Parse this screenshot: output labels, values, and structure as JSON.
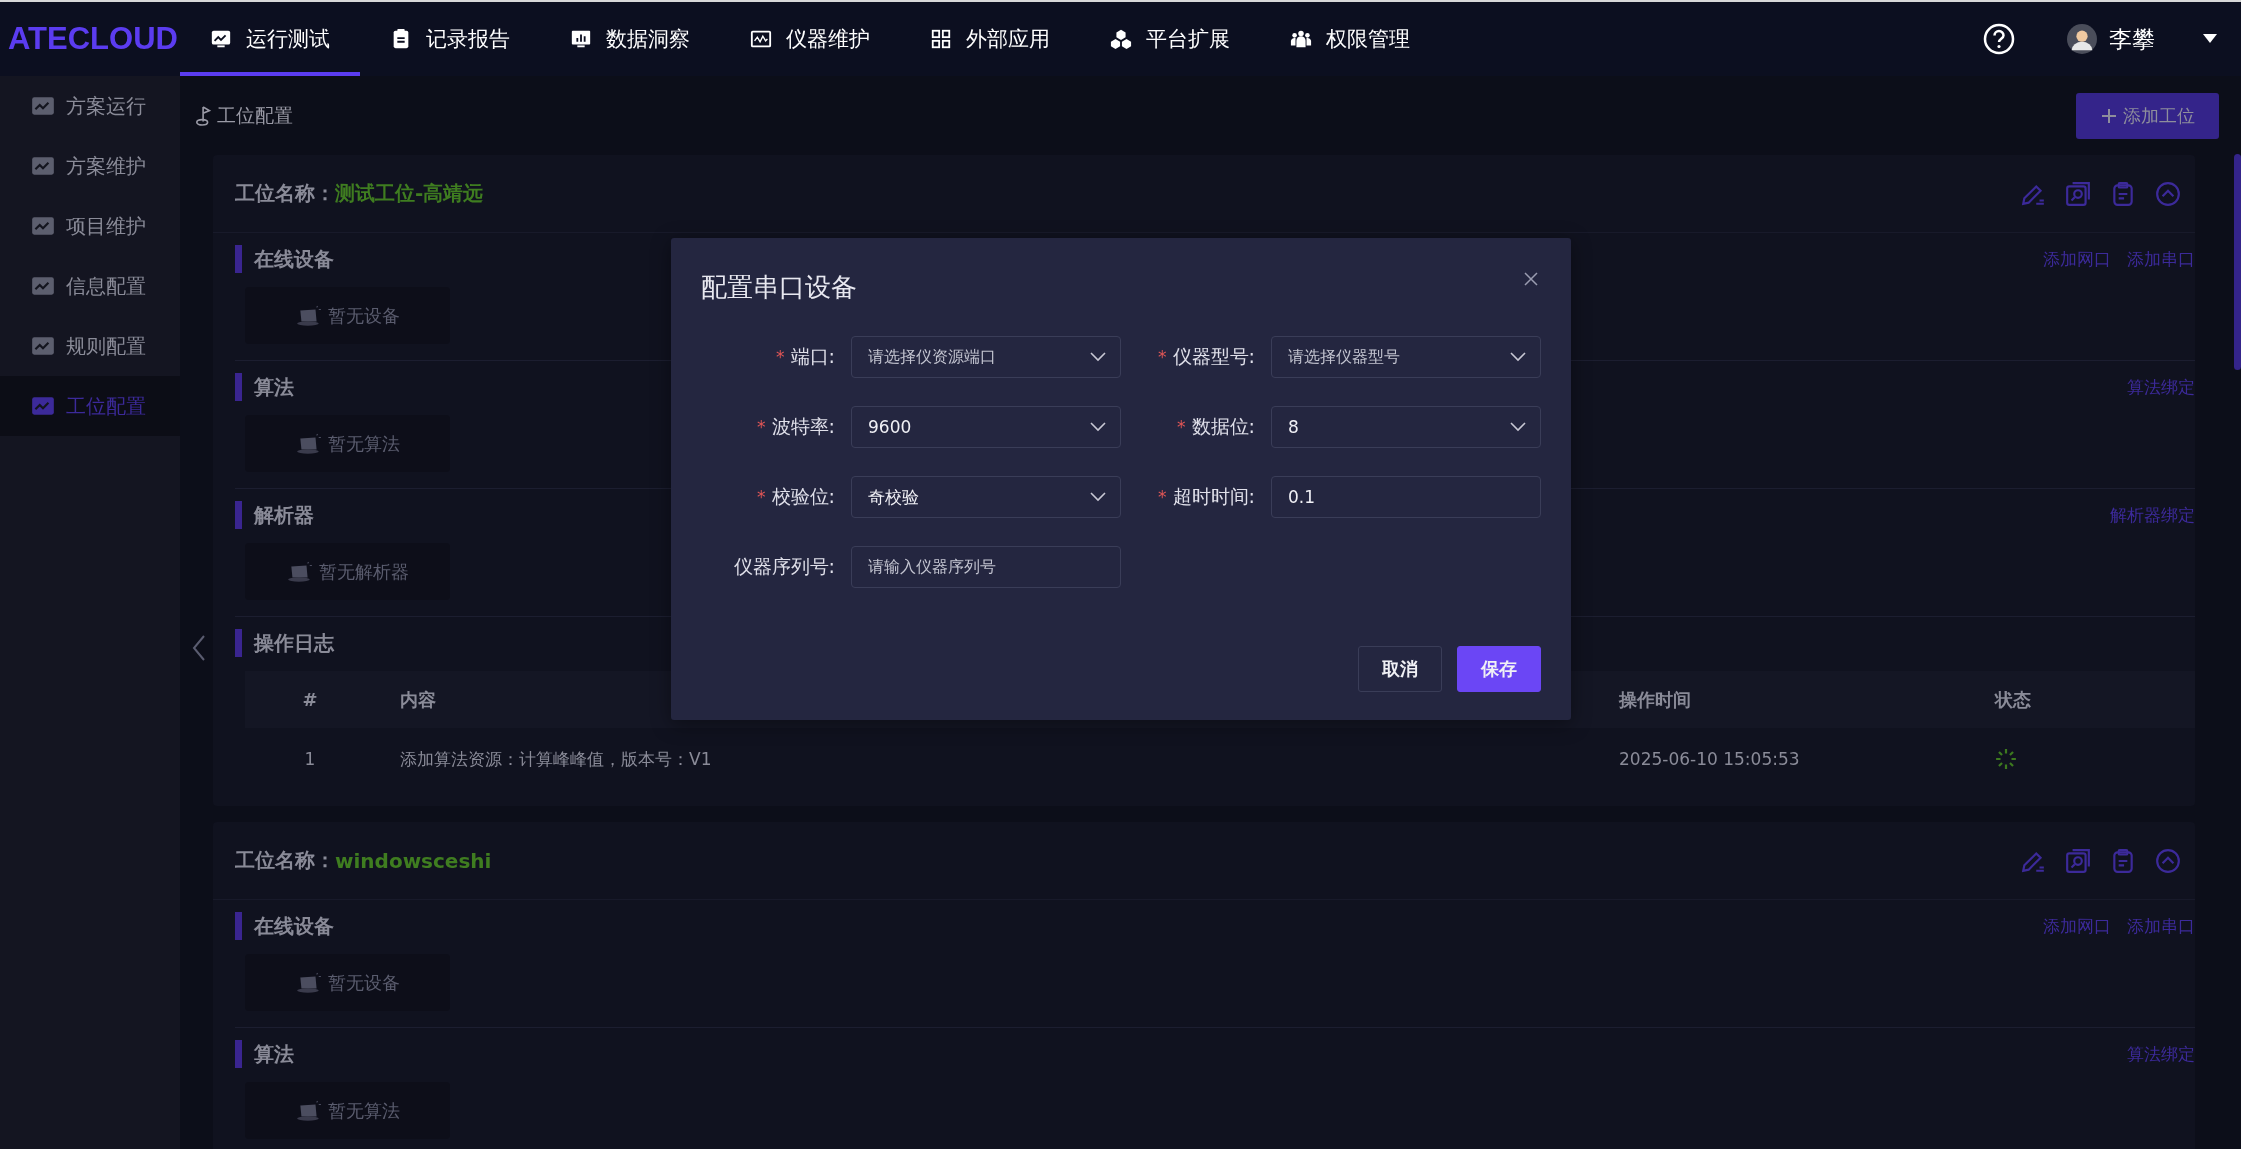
{
  "header": {
    "logo": "ATECLOUD",
    "nav": [
      {
        "label": "运行测试",
        "selected": true
      },
      {
        "label": "记录报告",
        "selected": false
      },
      {
        "label": "数据洞察",
        "selected": false
      },
      {
        "label": "仪器维护",
        "selected": false
      },
      {
        "label": "外部应用",
        "selected": false
      },
      {
        "label": "平台扩展",
        "selected": false
      },
      {
        "label": "权限管理",
        "selected": false
      }
    ],
    "user": "李攀"
  },
  "sidebar": {
    "items": [
      {
        "label": "方案运行",
        "selected": false
      },
      {
        "label": "方案维护",
        "selected": false
      },
      {
        "label": "项目维护",
        "selected": false
      },
      {
        "label": "信息配置",
        "selected": false
      },
      {
        "label": "规则配置",
        "selected": false
      },
      {
        "label": "工位配置",
        "selected": true
      }
    ]
  },
  "breadcrumb": "工位配置",
  "add_button": "添加工位",
  "stations": [
    {
      "label": "工位名称：",
      "name": "测试工位-高靖远",
      "sections": [
        {
          "kind": "empty",
          "title": "在线设备",
          "actions": [
            "添加网口",
            "添加串口"
          ],
          "empty": "暂无设备"
        },
        {
          "kind": "empty",
          "title": "算法",
          "actions": [
            "算法绑定"
          ],
          "empty": "暂无算法"
        },
        {
          "kind": "empty",
          "title": "解析器",
          "actions": [
            "解析器绑定"
          ],
          "empty": "暂无解析器"
        },
        {
          "kind": "log",
          "title": "操作日志",
          "columns": [
            "#",
            "内容",
            "操作时间",
            "状态"
          ],
          "rows": [
            {
              "index": "1",
              "content": "添加算法资源：计算峰峰值，版本号：V1",
              "time": "2025-06-10 15:05:53"
            }
          ]
        }
      ]
    },
    {
      "label": "工位名称：",
      "name": "windowsceshi",
      "sections": [
        {
          "kind": "empty",
          "title": "在线设备",
          "actions": [
            "添加网口",
            "添加串口"
          ],
          "empty": "暂无设备"
        },
        {
          "kind": "empty",
          "title": "算法",
          "actions": [
            "算法绑定"
          ],
          "empty": "暂无算法"
        }
      ]
    }
  ],
  "dialog": {
    "title": "配置串口设备",
    "fields": [
      {
        "label": "端口:",
        "required_mark": "*",
        "kind": "select",
        "placeholder": "请选择仪资源端口"
      },
      {
        "label": "仪器型号:",
        "required_mark": "*",
        "kind": "select",
        "placeholder": "请选择仪器型号"
      },
      {
        "label": "波特率:",
        "required_mark": "*",
        "kind": "select",
        "value": "9600"
      },
      {
        "label": "数据位:",
        "required_mark": "*",
        "kind": "select",
        "value": "8"
      },
      {
        "label": "校验位:",
        "required_mark": "*",
        "kind": "select",
        "value": "奇校验"
      },
      {
        "label": "超时时间:",
        "required_mark": "*",
        "kind": "input",
        "value": "0.1"
      },
      {
        "label": "仪器序列号:",
        "kind": "input",
        "placeholder": "请输入仪器序列号"
      }
    ],
    "buttons": [
      {
        "label": "取消",
        "kind": "secondary"
      },
      {
        "label": "保存",
        "kind": "primary"
      }
    ]
  }
}
